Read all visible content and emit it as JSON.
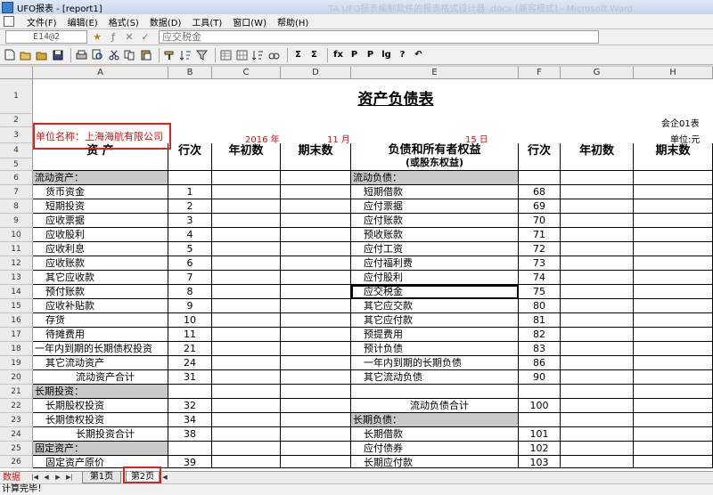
{
  "window": {
    "title": "UFO报表 - [report1]",
    "background_title": "TA UFO报表编制软件的报表格式设计器 .docx [兼容模式] - Microsoft Word"
  },
  "menu": [
    "文件(F)",
    "编辑(E)",
    "格式(S)",
    "数据(D)",
    "工具(T)",
    "窗口(W)",
    "帮助(H)"
  ],
  "editbar": {
    "cell_ref": "E14@2",
    "formula_value": "应交税金"
  },
  "toolbar": {
    "icons": [
      "new-icon",
      "open-icon",
      "open-folder-icon",
      "save-icon",
      "print-icon",
      "print-preview-icon",
      "cut-icon",
      "copy-icon",
      "paste-icon",
      "format-painter-icon",
      "sort-icon",
      "filter-icon",
      "insert-row-icon",
      "insert-column-icon",
      "sort-ascending-icon",
      "find-icon",
      "sum-icon",
      "sum-select-icon",
      "insert-function-icon",
      "insert-page-icon",
      "insert-sheet-icon",
      "lock-icon",
      "help-icon",
      "undo-icon"
    ],
    "labels": {
      "sum": "Σ",
      "sum_select": "Σ",
      "function": "fx",
      "page": "P",
      "sheet": "P",
      "lock": "lg",
      "help": "?",
      "undo": "↶"
    }
  },
  "columns": [
    "A",
    "B",
    "C",
    "D",
    "E",
    "F",
    "G",
    "H"
  ],
  "rows": [
    "1",
    "2",
    "3",
    "4",
    "5",
    "6",
    "7",
    "8",
    "9",
    "10",
    "11",
    "12",
    "13",
    "14",
    "15",
    "16",
    "17",
    "18",
    "19",
    "20",
    "21",
    "22",
    "23",
    "24",
    "25",
    "26"
  ],
  "report": {
    "title": "资产负债表",
    "form_code": "会企01表",
    "unit_label": "单位名称：上海海航有限公司",
    "year": "2016 年",
    "month": "11 月",
    "day": "15 日",
    "currency": "单位:元"
  },
  "header": {
    "asset": "资 产",
    "line_no": "行次",
    "begin": "年初数",
    "end": "期末数",
    "liability": "负债和所有者权益",
    "liability_sub": "(或股东权益)"
  },
  "left_rows": [
    {
      "label": "流动资产：",
      "no": ""
    },
    {
      "label": "货币资金",
      "no": "1"
    },
    {
      "label": "短期投资",
      "no": "2"
    },
    {
      "label": "应收票据",
      "no": "3"
    },
    {
      "label": "应收股利",
      "no": "4"
    },
    {
      "label": "应收利息",
      "no": "5"
    },
    {
      "label": "应收账款",
      "no": "6"
    },
    {
      "label": "其它应收款",
      "no": "7"
    },
    {
      "label": "预付账款",
      "no": "8"
    },
    {
      "label": "应收补贴款",
      "no": "9"
    },
    {
      "label": "存货",
      "no": "10"
    },
    {
      "label": "待摊费用",
      "no": "11"
    },
    {
      "label": "一年内到期的长期债权投资",
      "no": "21"
    },
    {
      "label": "其它流动资产",
      "no": "24"
    },
    {
      "label": "流动资产合计",
      "no": "31"
    },
    {
      "label": "长期投资：",
      "no": ""
    },
    {
      "label": "长期股权投资",
      "no": "32"
    },
    {
      "label": "长期债权投资",
      "no": "34"
    },
    {
      "label": "长期投资合计",
      "no": "38"
    },
    {
      "label": "固定资产：",
      "no": ""
    },
    {
      "label": "固定资产原价",
      "no": "39"
    }
  ],
  "right_rows": [
    {
      "label": "流动负债：",
      "no": ""
    },
    {
      "label": "短期借款",
      "no": "68"
    },
    {
      "label": "应付票据",
      "no": "69"
    },
    {
      "label": "应付账款",
      "no": "70"
    },
    {
      "label": "预收账款",
      "no": "71"
    },
    {
      "label": "应付工资",
      "no": "72"
    },
    {
      "label": "应付福利费",
      "no": "73"
    },
    {
      "label": "应付股利",
      "no": "74"
    },
    {
      "label": "应交税金",
      "no": "75"
    },
    {
      "label": "其它应交款",
      "no": "80"
    },
    {
      "label": "其它应付款",
      "no": "81"
    },
    {
      "label": "预提费用",
      "no": "82"
    },
    {
      "label": "预计负债",
      "no": "83"
    },
    {
      "label": "一年内到期的长期负债",
      "no": "86"
    },
    {
      "label": "其它流动负债",
      "no": "90"
    },
    {
      "label": "",
      "no": ""
    },
    {
      "label": "流动负债合计",
      "no": "100"
    },
    {
      "label": "长期负债：",
      "no": ""
    },
    {
      "label": "长期借款",
      "no": "101"
    },
    {
      "label": "应付债券",
      "no": "102"
    },
    {
      "label": "长期应付款",
      "no": "103"
    }
  ],
  "sheet_tabs": {
    "mode": "数据",
    "tab1": "第1页",
    "tab2": "第2页"
  },
  "status": "计算完毕！"
}
